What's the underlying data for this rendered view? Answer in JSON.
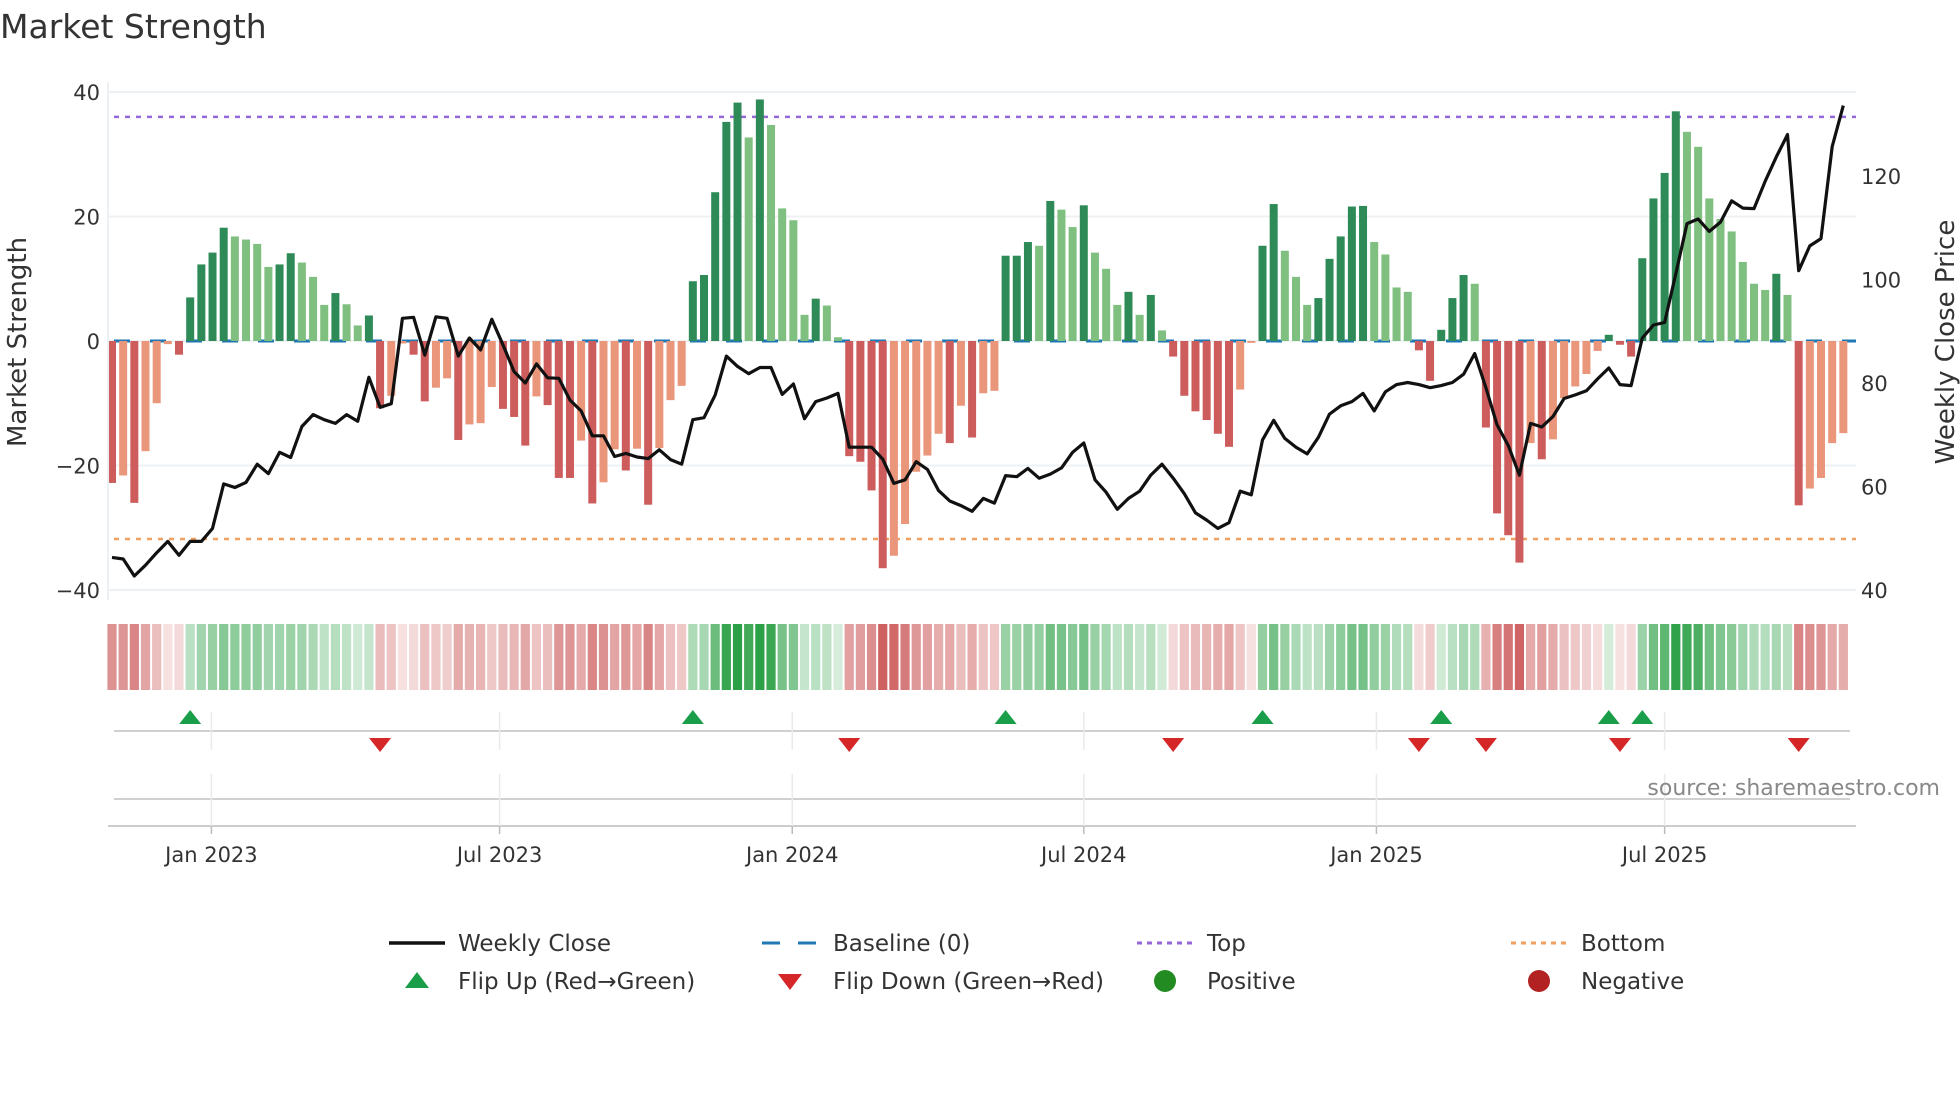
{
  "colors": {
    "strong_up": "#2e8b57",
    "weak_up": "#7fbf7f",
    "strong_down": "#cd5c5c",
    "weak_down": "#e9967a",
    "baseline": "#1f77b4",
    "top": "#9467db",
    "bottom": "#f0a060",
    "close": "#111111",
    "flip_up": "#1a9e4a",
    "flip_down": "#d62728",
    "positive": "#228b22",
    "negative": "#b22222",
    "strip_pos": "44,160,70",
    "strip_neg": "205,92,92"
  },
  "chart_data": {
    "type": "bar",
    "title": "Market Strength",
    "ylabel": "Market Strength",
    "y2label": "Weekly Close Price",
    "ylim": [
      -40,
      40
    ],
    "y2lim": [
      40,
      140
    ],
    "yticks": [
      "40",
      "20",
      "0",
      "−20",
      "−40"
    ],
    "ytick_values": [
      40,
      20,
      0,
      -20,
      -40
    ],
    "y2ticks": [
      "120",
      "100",
      "80",
      "60",
      "40"
    ],
    "y2tick_values": [
      120,
      100,
      80,
      60,
      40
    ],
    "xticks": [
      {
        "label": "Jan 2023",
        "week": 8.9
      },
      {
        "label": "Jul 2023",
        "week": 34.7
      },
      {
        "label": "Jan 2024",
        "week": 60.9
      },
      {
        "label": "Jul 2024",
        "week": 87.0
      },
      {
        "label": "Jan 2025",
        "week": 113.2
      },
      {
        "label": "Jul 2025",
        "week": 139.0
      }
    ],
    "top_level": 36,
    "bottom_level": -31.8,
    "strength": [
      -22.8,
      -21.6,
      -26,
      -17.7,
      -10,
      -0.5,
      -2.2,
      7,
      12.3,
      14.2,
      18.2,
      16.8,
      16.3,
      15.6,
      11.9,
      12.3,
      14.1,
      12.6,
      10.3,
      5.8,
      7.7,
      5.9,
      2.5,
      4.1,
      -10.8,
      -8.8,
      -0.4,
      -2.2,
      -9.7,
      -7.5,
      -6,
      -15.9,
      -13.4,
      -13.2,
      -7.4,
      -10.9,
      -12.2,
      -16.8,
      -8.9,
      -10.3,
      -22,
      -22,
      -16,
      -26.1,
      -22.7,
      -17.4,
      -20.8,
      -17.3,
      -26.3,
      -17.2,
      -9.5,
      -7.2,
      9.6,
      10.6,
      23.9,
      35.2,
      38.3,
      32.7,
      38.8,
      34.7,
      21.3,
      19.4,
      4.2,
      6.8,
      5.7,
      0.6,
      -18.5,
      -19.4,
      -24,
      -36.5,
      -34.5,
      -29.4,
      -21,
      -18.4,
      -14.9,
      -16.4,
      -10.4,
      -15.5,
      -8.4,
      -8,
      13.7,
      13.7,
      15.9,
      15.3,
      22.5,
      21.1,
      18.3,
      21.8,
      14.2,
      11.6,
      5.8,
      7.9,
      4.2,
      7.4,
      1.7,
      -2.5,
      -8.8,
      -11.3,
      -12.7,
      -14.9,
      -17,
      -7.8,
      -0.3,
      15.3,
      22,
      14.5,
      10.3,
      5.8,
      6.9,
      13.2,
      16.8,
      21.6,
      21.7,
      15.9,
      13.9,
      8.6,
      7.9,
      -1.5,
      -6.4,
      1.8,
      6.9,
      10.6,
      9.2,
      -13.9,
      -27.7,
      -31.2,
      -35.6,
      -16.4,
      -19,
      -15.8,
      -9.2,
      -7.3,
      -5.3,
      -1.6,
      1,
      -0.6,
      -2.5,
      13.3,
      22.9,
      27,
      36.9,
      33.6,
      31.2,
      22.9,
      19.6,
      17.6,
      12.7,
      9.2,
      8.2,
      10.8,
      7.4,
      -26.4,
      -23.7,
      -22,
      -16.4,
      -14.8
    ],
    "weekly_close": [
      46.3,
      46,
      42.7,
      44.8,
      47.2,
      49.4,
      46.7,
      49.4,
      49.4,
      51.9,
      60.5,
      59.8,
      60.8,
      64.3,
      62.5,
      66.6,
      65.6,
      71.6,
      73.9,
      72.9,
      72.2,
      73.9,
      72.6,
      81.1,
      75.3,
      76,
      92.5,
      92.7,
      85.4,
      92.8,
      92.5,
      85.2,
      88.7,
      86.4,
      92.3,
      87.4,
      82.2,
      80,
      83.7,
      81,
      80.9,
      76.7,
      74.6,
      69.8,
      69.8,
      65.8,
      66.4,
      65.7,
      65.4,
      67.1,
      65.2,
      64.3,
      72.9,
      73.3,
      77.7,
      85.2,
      83.2,
      81.8,
      83,
      83,
      77.8,
      79.8,
      73.1,
      76.4,
      77.1,
      78,
      67.6,
      67.6,
      67.6,
      65.3,
      60.6,
      61.3,
      64.8,
      63.3,
      59.2,
      57.2,
      56.3,
      55.2,
      57.7,
      56.8,
      62.1,
      61.9,
      63.5,
      61.6,
      62.4,
      63.6,
      66.6,
      68.4,
      61.3,
      58.9,
      55.6,
      57.7,
      59.1,
      62.2,
      64.3,
      61.6,
      58.6,
      54.9,
      53.5,
      51.9,
      53,
      59.1,
      58.4,
      69,
      72.8,
      69.3,
      67.6,
      66.3,
      69.5,
      74,
      75.6,
      76.4,
      78,
      74.6,
      78.3,
      79.7,
      80.1,
      79.7,
      79.1,
      79.5,
      80.1,
      81.7,
      85.7,
      79.1,
      71.9,
      67.9,
      62.2,
      72.2,
      71.5,
      73.5,
      77,
      77.7,
      78.5,
      80.8,
      82.9,
      79.7,
      79.5,
      88.7,
      91.2,
      91.7,
      101.1,
      110.8,
      111.7,
      109.3,
      111.1,
      115.2,
      113.8,
      113.7,
      119,
      123.7,
      128,
      101.7,
      106.5,
      107.9,
      125.7,
      133.6
    ],
    "legend": {
      "placement": "bottom",
      "items": [
        {
          "label": "Weekly Close",
          "kind": "line"
        },
        {
          "label": "Baseline (0)",
          "kind": "dash"
        },
        {
          "label": "Top",
          "kind": "dot-top"
        },
        {
          "label": "Bottom",
          "kind": "dot-bottom"
        },
        {
          "label": "Flip Up (Red→Green)",
          "kind": "tri-up"
        },
        {
          "label": "Flip Down (Green→Red)",
          "kind": "tri-down"
        },
        {
          "label": "Positive",
          "kind": "circle-pos"
        },
        {
          "label": "Negative",
          "kind": "circle-neg"
        }
      ]
    },
    "source": "source: sharemaestro.com"
  }
}
